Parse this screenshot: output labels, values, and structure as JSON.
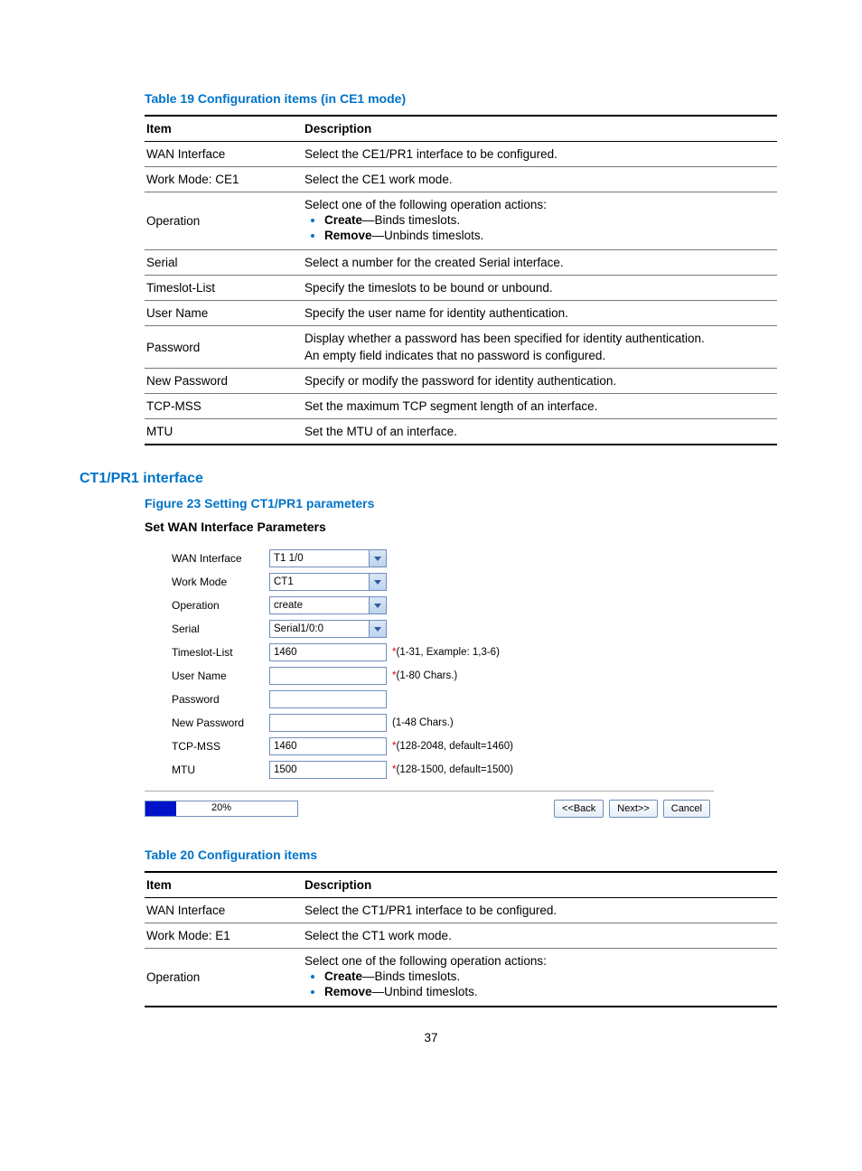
{
  "table19": {
    "caption": "Table 19 Configuration items (in CE1 mode)",
    "headers": {
      "item": "Item",
      "desc": "Description"
    },
    "rows": [
      {
        "item": "WAN Interface",
        "desc": "Select the CE1/PR1 interface to be configured."
      },
      {
        "item": "Work Mode: CE1",
        "desc": "Select the CE1 work mode."
      },
      {
        "item": "Operation",
        "lead": "Select one of the following operation actions:",
        "bullets": [
          {
            "bold": "Create",
            "rest": "—Binds timeslots."
          },
          {
            "bold": "Remove",
            "rest": "—Unbinds timeslots."
          }
        ]
      },
      {
        "item": "Serial",
        "desc": "Select a number for the created Serial interface."
      },
      {
        "item": "Timeslot-List",
        "desc": "Specify the timeslots to be bound or unbound."
      },
      {
        "item": "User Name",
        "desc": "Specify the user name for identity authentication."
      },
      {
        "item": "Password",
        "desc": "Display whether a password has been specified for identity authentication.",
        "desc2": "An empty field indicates that no password is configured."
      },
      {
        "item": "New Password",
        "desc": "Specify or modify the password for identity authentication."
      },
      {
        "item": "TCP-MSS",
        "desc": "Set the maximum TCP segment length of an interface."
      },
      {
        "item": "MTU",
        "desc": "Set the MTU of an interface."
      }
    ]
  },
  "section_heading": "CT1/PR1 interface",
  "figure23": {
    "caption": "Figure 23 Setting CT1/PR1 parameters",
    "title": "Set WAN Interface Parameters",
    "fields": [
      {
        "label": "WAN Interface",
        "type": "dropdown",
        "value": "T1 1/0",
        "hint": ""
      },
      {
        "label": "Work Mode",
        "type": "dropdown",
        "value": "CT1",
        "hint": ""
      },
      {
        "label": "Operation",
        "type": "dropdown",
        "value": "create",
        "hint": ""
      },
      {
        "label": "Serial",
        "type": "dropdown",
        "value": "Serial1/0:0",
        "hint": ""
      },
      {
        "label": "Timeslot-List",
        "type": "input",
        "value": "1460",
        "hint": "*(1-31, Example: 1,3-6)",
        "star": true
      },
      {
        "label": "User Name",
        "type": "input",
        "value": "",
        "hint": "*(1-80 Chars.)",
        "star": true
      },
      {
        "label": "Password",
        "type": "input",
        "value": "",
        "hint": ""
      },
      {
        "label": "New Password",
        "type": "input",
        "value": "",
        "hint": "(1-48 Chars.)"
      },
      {
        "label": "TCP-MSS",
        "type": "input",
        "value": "1460",
        "hint": "*(128-2048, default=1460)",
        "star": true
      },
      {
        "label": "MTU",
        "type": "input",
        "value": "1500",
        "hint": "*(128-1500, default=1500)",
        "star": true
      }
    ],
    "progress_text": "20%",
    "buttons": {
      "back": "<<Back",
      "next": "Next>>",
      "cancel": "Cancel"
    }
  },
  "table20": {
    "caption": "Table 20 Configuration items",
    "headers": {
      "item": "Item",
      "desc": "Description"
    },
    "rows": [
      {
        "item": "WAN Interface",
        "desc": "Select the CT1/PR1 interface to be configured."
      },
      {
        "item": "Work Mode: E1",
        "desc": "Select the CT1 work mode."
      },
      {
        "item": "Operation",
        "lead": "Select one of the following operation actions:",
        "bullets": [
          {
            "bold": "Create",
            "rest": "—Binds timeslots."
          },
          {
            "bold": "Remove",
            "rest": "—Unbind timeslots."
          }
        ]
      }
    ]
  },
  "page_number": "37"
}
